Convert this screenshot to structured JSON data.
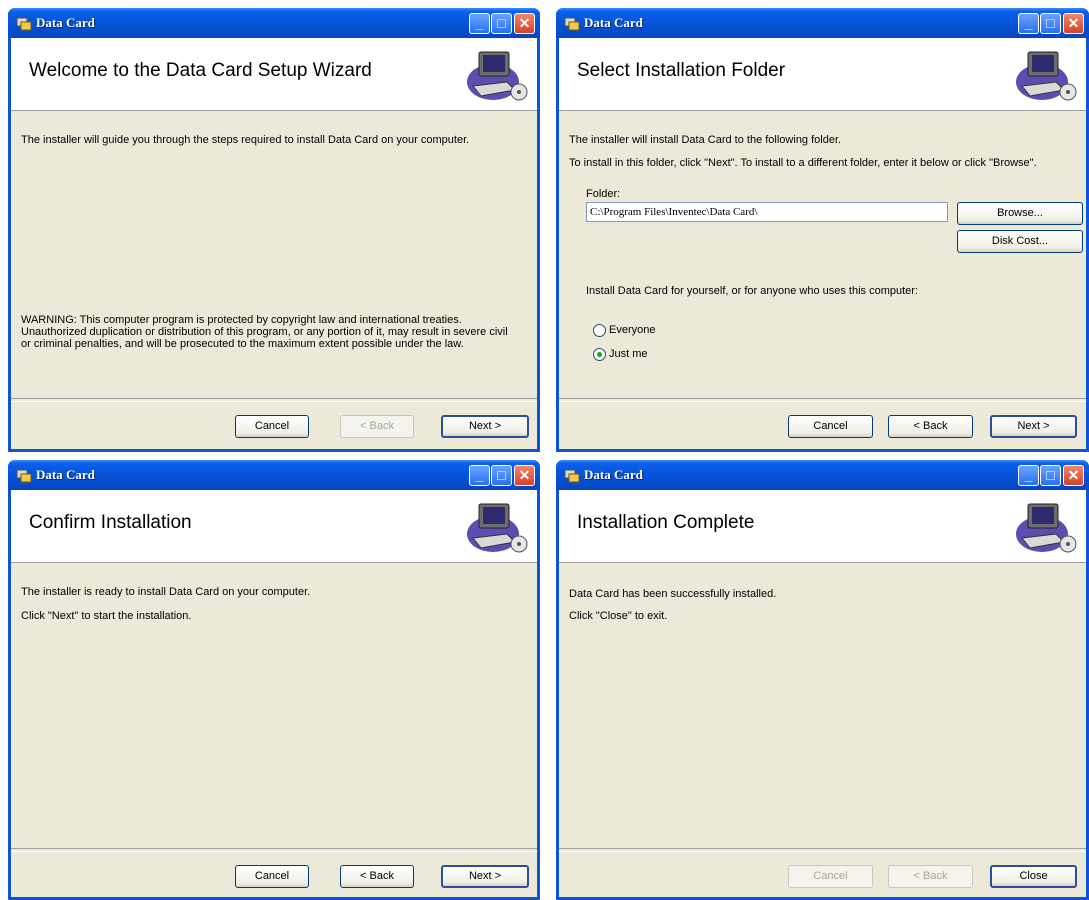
{
  "app_title": "Data Card",
  "colors": {
    "titlebar": "#0552d6",
    "client": "#ece9d8",
    "banner": "#ffffff",
    "close_button": "#d4422a"
  },
  "icons": {
    "title": "installer-icon",
    "banner": "computer-cd-icon"
  },
  "window_controls": {
    "minimize": "minimize-icon",
    "maximize": "maximize-icon",
    "close": "close-icon"
  },
  "welcome": {
    "title": "Welcome to the Data Card Setup Wizard",
    "intro": "The installer will guide you through the steps required to install Data Card on your computer.",
    "warning_lines": [
      "WARNING: This computer program is protected by copyright law and international treaties.",
      "Unauthorized duplication or distribution of this program, or any portion of it, may result in severe civil",
      "or criminal penalties, and will be prosecuted to the maximum extent possible under the law."
    ],
    "buttons": {
      "cancel": "Cancel",
      "back": "< Back",
      "next": "Next >"
    }
  },
  "folder": {
    "title": "Select Installation Folder",
    "line1": "The installer will install Data Card to the following folder.",
    "line2": "To install in this folder, click \"Next\". To install to a different folder, enter it below or click \"Browse\".",
    "folder_label": "Folder:",
    "folder_value": "C:\\Program Files\\Inventec\\Data Card\\",
    "browse": "Browse...",
    "disk_cost": "Disk Cost...",
    "install_for": "Install Data Card for yourself, or for anyone who uses this computer:",
    "options": [
      {
        "label": "Everyone",
        "selected": false
      },
      {
        "label": "Just me",
        "selected": true
      }
    ],
    "buttons": {
      "cancel": "Cancel",
      "back": "< Back",
      "next": "Next >"
    }
  },
  "confirm": {
    "title": "Confirm Installation",
    "line1": "The installer is ready to install Data Card on your computer.",
    "line2": "Click \"Next\" to start the installation.",
    "buttons": {
      "cancel": "Cancel",
      "back": "< Back",
      "next": "Next >"
    }
  },
  "complete": {
    "title": "Installation Complete",
    "line1": "Data Card has been successfully installed.",
    "line2": "Click \"Close\" to exit.",
    "buttons": {
      "cancel": "Cancel",
      "back": "< Back",
      "close": "Close"
    }
  }
}
